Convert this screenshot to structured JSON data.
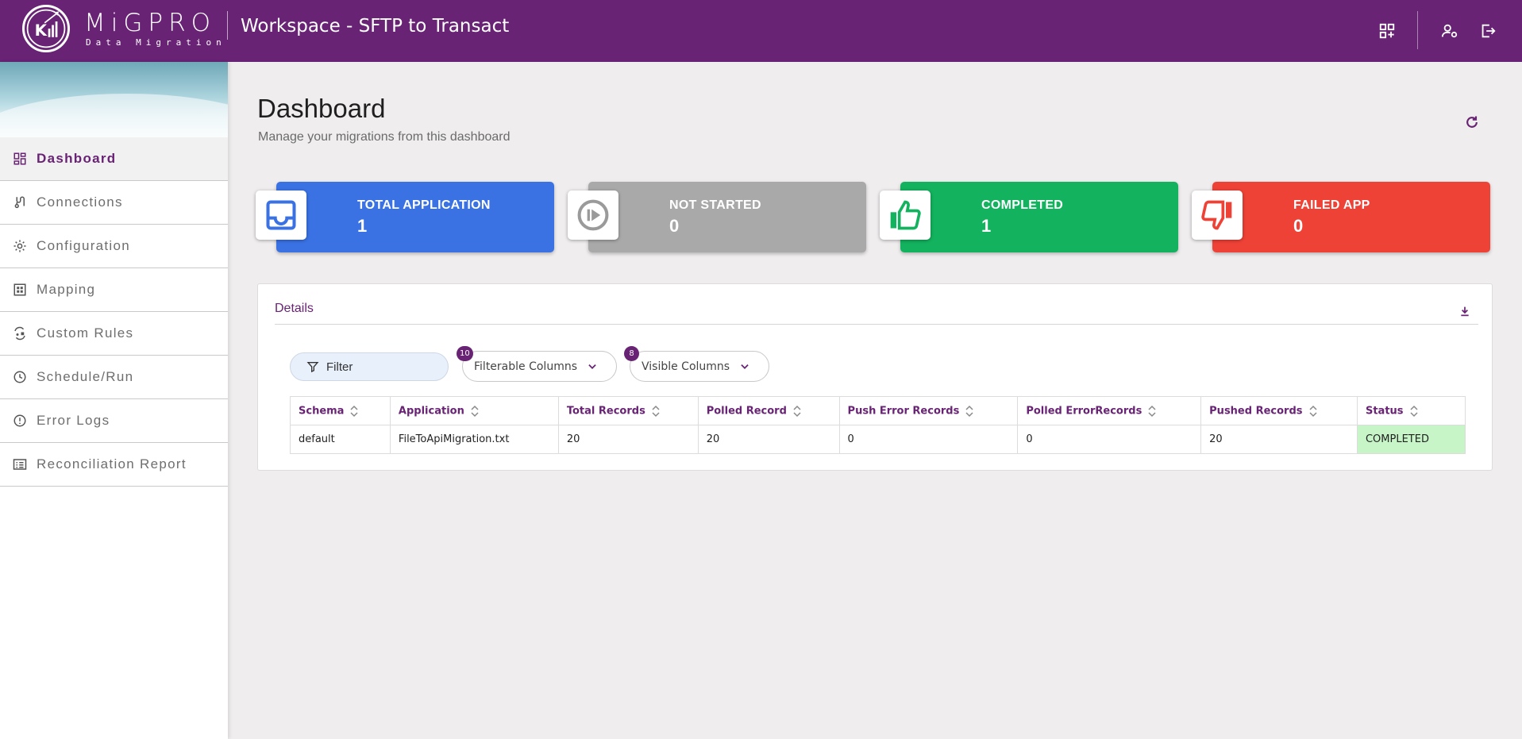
{
  "header": {
    "brand_name": "MiGPRO",
    "brand_sub": "Data Migration",
    "workspace_title": "Workspace - SFTP to Transact",
    "icons": [
      "apps-add-icon",
      "user-settings-icon",
      "logout-icon"
    ]
  },
  "sidebar": {
    "items": [
      {
        "label": "Dashboard",
        "icon": "dashboard-icon",
        "active": true
      },
      {
        "label": "Connections",
        "icon": "connections-icon"
      },
      {
        "label": "Configuration",
        "icon": "gear-icon"
      },
      {
        "label": "Mapping",
        "icon": "grid-icon"
      },
      {
        "label": "Custom Rules",
        "icon": "rules-icon"
      },
      {
        "label": "Schedule/Run",
        "icon": "clock-icon"
      },
      {
        "label": "Error Logs",
        "icon": "alert-icon"
      },
      {
        "label": "Reconciliation Report",
        "icon": "report-icon"
      }
    ]
  },
  "page": {
    "title": "Dashboard",
    "subtitle": "Manage your migrations from this dashboard"
  },
  "cards": [
    {
      "title": "TOTAL APPLICATION",
      "value": "1",
      "color": "#3a72e3",
      "icon": "inbox-icon"
    },
    {
      "title": "NOT STARTED",
      "value": "0",
      "color": "#a9a9a9",
      "icon": "play-circle-icon"
    },
    {
      "title": "COMPLETED",
      "value": "1",
      "color": "#13b25e",
      "icon": "thumbs-up-icon"
    },
    {
      "title": "FAILED APP",
      "value": "0",
      "color": "#ef4237",
      "icon": "thumbs-down-icon"
    }
  ],
  "details": {
    "title": "Details",
    "filter_label": "Filter",
    "filterable_columns": {
      "label": "Filterable Columns",
      "count": "10"
    },
    "visible_columns": {
      "label": "Visible Columns",
      "count": "8"
    },
    "columns": [
      "Schema",
      "Application",
      "Total Records",
      "Polled Record",
      "Push Error Records",
      "Polled ErrorRecords",
      "Pushed Records",
      "Status"
    ],
    "rows": [
      [
        "default",
        "FileToApiMigration.txt",
        "20",
        "20",
        "0",
        "0",
        "20",
        "COMPLETED"
      ]
    ]
  },
  "colors": {
    "brand": "#682374",
    "completed_status_bg": "#c8f5c8"
  }
}
